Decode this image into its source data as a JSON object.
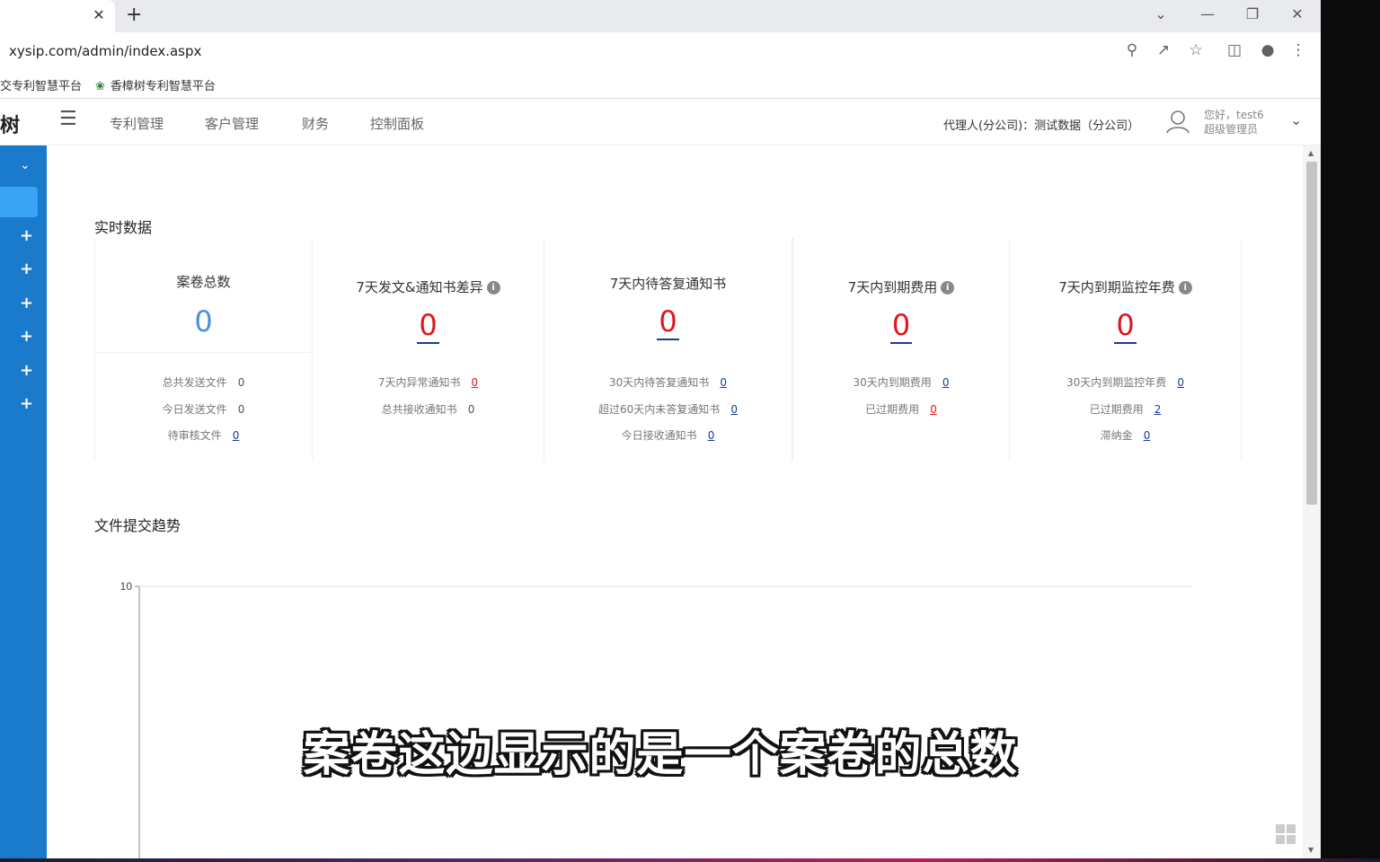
{
  "browser": {
    "tab_close": "✕",
    "new_tab": "+",
    "url": "xysip.com/admin/index.aspx",
    "bookmarks": [
      {
        "label": "交专利智慧平台"
      },
      {
        "label": "香樟树专利智慧平台"
      }
    ]
  },
  "header": {
    "logo_tail": "树",
    "nav": [
      {
        "label": "专利管理"
      },
      {
        "label": "客户管理"
      },
      {
        "label": "财务"
      },
      {
        "label": "控制面板"
      }
    ],
    "agent_info": "代理人(分公司)：测试数据（分公司）",
    "user_greeting": "您好，test6",
    "user_role": "超级管理员"
  },
  "sections": {
    "realtime_title": "实时数据",
    "trend_title": "文件提交趋势"
  },
  "stats": [
    {
      "title": "案卷总数",
      "value": "0",
      "lines": [
        {
          "label": "总共发送文件",
          "value": "0"
        },
        {
          "label": "今日发送文件",
          "value": "0"
        },
        {
          "label": "待审核文件",
          "value": "0"
        }
      ]
    },
    {
      "title": "7天发文&通知书差异",
      "value": "0",
      "lines": [
        {
          "label": "7天内异常通知书",
          "value": "0"
        },
        {
          "label": "总共接收通知书",
          "value": "0"
        }
      ]
    },
    {
      "title": "7天内待答复通知书",
      "value": "0",
      "lines": [
        {
          "label": "30天内待答复通知书",
          "value": "0"
        },
        {
          "label": "超过60天内未答复通知书",
          "value": "0"
        },
        {
          "label": "今日接收通知书",
          "value": "0"
        }
      ]
    },
    {
      "title": "7天内到期费用",
      "value": "0",
      "lines": [
        {
          "label": "30天内到期费用",
          "value": "0"
        },
        {
          "label": "已过期费用",
          "value": "0"
        }
      ]
    },
    {
      "title": "7天内到期监控年费",
      "value": "0",
      "lines": [
        {
          "label": "30天内到期监控年费",
          "value": "0"
        },
        {
          "label": "已过期费用",
          "value": "2"
        },
        {
          "label": "滞纳金",
          "value": "0"
        }
      ]
    }
  ],
  "chart_data": {
    "type": "line",
    "title": "文件提交趋势",
    "y_ticks": [
      "10"
    ],
    "ylim": [
      0,
      10
    ],
    "grid": true,
    "series": []
  },
  "subtitle": "案卷这边显示的是一个案卷的总数",
  "colors": {
    "sidebar": "#1a7acb",
    "sidebar_active": "#3aa4f5",
    "value_blue": "#4a90d9",
    "value_red": "#e0161b"
  }
}
